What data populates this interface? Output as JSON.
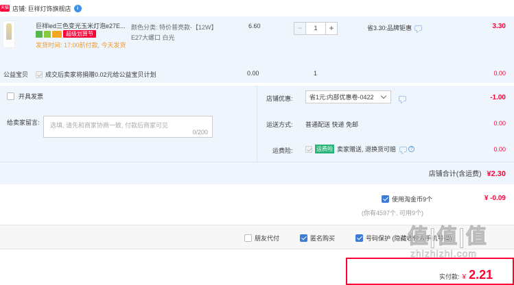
{
  "shop": {
    "badge": "天猫",
    "label": "店铺:",
    "name": "巨祥灯饰旗舰店",
    "chat_badge": "i"
  },
  "item": {
    "title": "巨祥led三色变光玉米灯泡e27E...",
    "promo_tag": "超级划算节",
    "ship_time": "发货时间: 17:00前付款, 今天发货",
    "sku_line1": "颜色分类: 特价普亮款-【12W】",
    "sku_line2": "E27大螺口 白光",
    "price": "6.60",
    "qty": "1",
    "discount": "省3.30:品牌钜惠",
    "subtotal": "3.30"
  },
  "charity": {
    "label": "公益宝贝",
    "text": "成交后卖家将捐赠0.02元给公益宝贝计划",
    "price": "0.00",
    "qty": "1",
    "subtotal": "0.00"
  },
  "invoice": {
    "label": "开具发票"
  },
  "message": {
    "label": "给卖家留言:",
    "placeholder": "选填, 请先和商家协商一致, 付款后商家可见",
    "counter": "0/200"
  },
  "coupon": {
    "label": "店铺优惠:",
    "value": "省1元:内部优惠卷-0422",
    "amount": "-1.00"
  },
  "delivery": {
    "label": "运送方式:",
    "value": "普通配送 快递 免邮",
    "amount": "0.00"
  },
  "insurance": {
    "label": "运费险:",
    "badge": "运费险",
    "value": "卖家赠送, 退换货可赔",
    "amount": "0.00"
  },
  "shop_total": {
    "label": "店铺合计(含运费)",
    "amount": "¥2.30"
  },
  "taojinbi": {
    "label": "使用淘金币9个",
    "amount": "¥ -0.09",
    "note": "(你有4597个, 可用9个)"
  },
  "options": {
    "friend_pay": "朋友代付",
    "anonymous": "匿名购买",
    "protect": "号码保护 (隐藏收件人手机号码)"
  },
  "payment": {
    "label": "实付款:",
    "currency": "¥",
    "amount": "2.21"
  },
  "watermark": {
    "brand": "值|值|值",
    "site": "zhizhizhi.com"
  },
  "colors": {
    "accent": "#ff0036",
    "panel": "#eef5fd",
    "check": "#3c7bd6"
  }
}
